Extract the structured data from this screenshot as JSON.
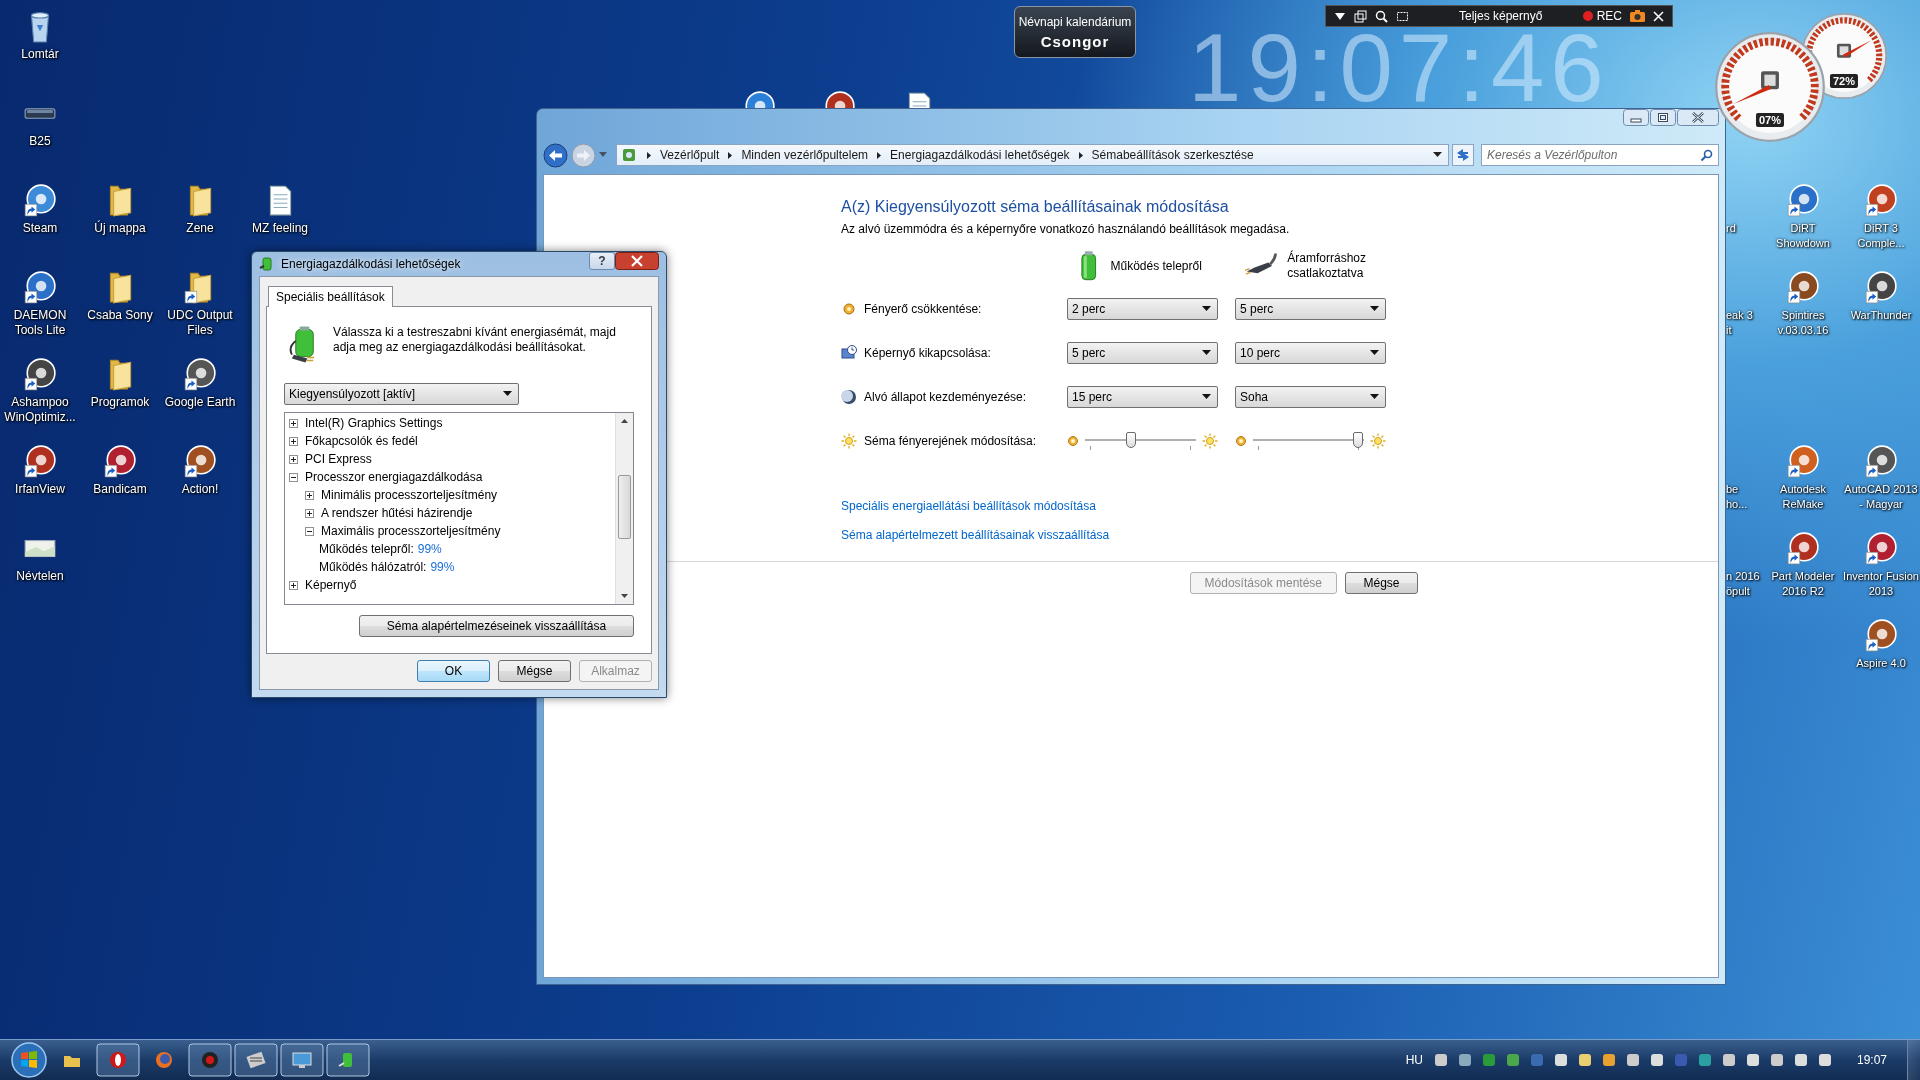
{
  "desktop": {
    "left_icons": [
      {
        "label": "Lomtár",
        "kind": "bin",
        "shortcut": false
      },
      {
        "label": "B25",
        "kind": "drive",
        "shortcut": false
      },
      {
        "label": "Steam",
        "kind": "app",
        "shortcut": true
      },
      {
        "label": "Új mappa",
        "kind": "folder",
        "shortcut": false
      },
      {
        "label": "Zene",
        "kind": "folder",
        "shortcut": false
      },
      {
        "label": "MZ feeling",
        "kind": "document",
        "shortcut": false
      },
      {
        "label": "DAEMON Tools Lite",
        "kind": "app",
        "shortcut": true
      },
      {
        "label": "Csaba Sony",
        "kind": "folder",
        "shortcut": false
      },
      {
        "label": "UDC Output Files",
        "kind": "folder",
        "shortcut": true
      },
      {
        "label": "Ashampoo WinOptimiz...",
        "kind": "app",
        "shortcut": true
      },
      {
        "label": "Programok",
        "kind": "folder",
        "shortcut": false
      },
      {
        "label": "Google Earth",
        "kind": "app",
        "shortcut": true
      },
      {
        "label": "IrfanView",
        "kind": "app",
        "shortcut": true
      },
      {
        "label": "Bandicam",
        "kind": "app",
        "shortcut": true
      },
      {
        "label": "Action!",
        "kind": "app",
        "shortcut": true
      },
      {
        "label": "Névtelen",
        "kind": "image",
        "shortcut": false
      }
    ],
    "right_icons": [
      {
        "label": "DiRT Showdown",
        "kind": "app",
        "shortcut": true
      },
      {
        "label": "DiRT 3 Comple...",
        "kind": "app",
        "shortcut": true
      },
      {
        "label": "Spintires v.03.03.16",
        "kind": "app",
        "shortcut": true
      },
      {
        "label": "WarThunder",
        "kind": "app",
        "shortcut": true
      },
      {
        "label": "Autodesk ReMake",
        "kind": "app",
        "shortcut": true
      },
      {
        "label": "AutoCAD 2013 - Magyar",
        "kind": "app",
        "shortcut": true
      },
      {
        "label": "Part Modeler 2016 R2",
        "kind": "app",
        "shortcut": true
      },
      {
        "label": "Inventor Fusion 2013",
        "kind": "app",
        "shortcut": true
      },
      {
        "label": "Aspire 4.0",
        "kind": "app",
        "shortcut": true
      }
    ],
    "partial_labels": [
      {
        "lines": [
          "rd"
        ]
      },
      {
        "lines": [
          "eak 3",
          "it"
        ]
      },
      {
        "lines": [
          "be",
          "ho..."
        ]
      },
      {
        "lines": [
          "n 2016",
          "öpult"
        ]
      }
    ]
  },
  "nameday_gadget": {
    "title": "Névnapi kalendárium",
    "name": "Csongor"
  },
  "clock": {
    "time": "19:07:46"
  },
  "recorder": {
    "mode": "Teljes képernyő",
    "rec": "REC"
  },
  "meters": [
    {
      "reading": "07%"
    },
    {
      "reading": "72%"
    }
  ],
  "control_panel": {
    "address": [
      "Vezérlőpult",
      "Minden vezérlőpultelem",
      "Energiagazdálkodási lehetőségek",
      "Sémabeállítások szerkesztése"
    ],
    "search": {
      "placeholder": "Keresés a Vezérlőpulton"
    },
    "heading": "A(z) Kiegyensúlyozott séma beállításainak módosítása",
    "subheading": "Az alvó üzemmódra és a képernyőre vonatkozó használandó beállítások megadása.",
    "columns": [
      {
        "label": "Működés telepről",
        "kind": "battery"
      },
      {
        "label": "Áramforráshoz csatlakoztatva",
        "kind": "plug"
      }
    ],
    "settings": [
      {
        "label": "Fényerő csökkentése:",
        "kind": "dropdown",
        "values": [
          "2 perc",
          "5 perc"
        ]
      },
      {
        "label": "Képernyő kikapcsolása:",
        "kind": "dropdown",
        "values": [
          "5 perc",
          "10 perc"
        ]
      },
      {
        "label": "Alvó állapot kezdeményezése:",
        "kind": "dropdown",
        "values": [
          "15 perc",
          "Soha"
        ]
      },
      {
        "label": "Séma fényerejének módosítása:",
        "kind": "slider",
        "sliders": [
          {
            "level": 0.41
          },
          {
            "level": 0.95
          }
        ]
      }
    ],
    "links": [
      "Speciális energiaellátási beállítások módosítása",
      "Séma alapértelmezett beállításainak visszaállítása"
    ],
    "buttons": [
      {
        "label": "Módosítások mentése",
        "disabled": true
      },
      {
        "label": "Mégse",
        "disabled": false
      }
    ]
  },
  "dialog": {
    "title": "Energiagazdálkodási lehetőségek",
    "help_glyph": "?",
    "tabs": [
      {
        "label": "Speciális beállítások",
        "selected": true
      }
    ],
    "intro": "Válassza ki a testreszabni kívánt energiasémát, majd adja meg az energiagazdálkodási beállításokat.",
    "plan": "Kiegyensúlyozott [aktív]",
    "tree": [
      {
        "label": "Intel(R) Graphics Settings",
        "expanded": false
      },
      {
        "label": "Főkapcsolók és fedél",
        "expanded": false
      },
      {
        "label": "PCI Express",
        "expanded": false
      },
      {
        "label": "Processzor energiagazdálkodása",
        "expanded": true,
        "children": [
          {
            "label": "Minimális processzorteljesítmény",
            "expanded": false
          },
          {
            "label": "A rendszer hűtési házirendje",
            "expanded": false
          },
          {
            "label": "Maximális processzorteljesítmény",
            "expanded": true,
            "children": [
              {
                "label": "Működés telepről:",
                "value": "99%"
              },
              {
                "label": "Működés hálózatról:",
                "value": "99%"
              }
            ]
          }
        ]
      },
      {
        "label": "Képernyő",
        "expanded": false
      }
    ],
    "reset_button": "Séma alapértelmezéseinek visszaállítása",
    "buttons": [
      {
        "label": "OK",
        "focused": true,
        "disabled": false
      },
      {
        "label": "Mégse",
        "focused": false,
        "disabled": false
      },
      {
        "label": "Alkalmaz",
        "focused": false,
        "disabled": true
      }
    ]
  },
  "taskbar": {
    "buttons": [
      {
        "running": false
      },
      {
        "running": true
      },
      {
        "running": false
      },
      {
        "running": true
      },
      {
        "running": true
      },
      {
        "running": true
      },
      {
        "running": true
      }
    ],
    "language": "HU",
    "time": "19:07"
  }
}
